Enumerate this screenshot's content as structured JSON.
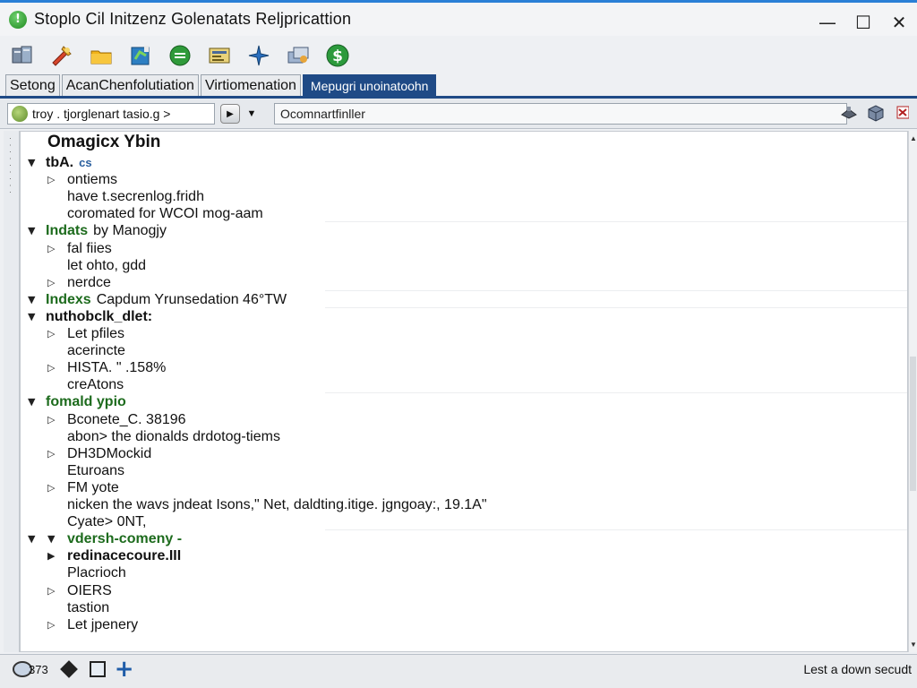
{
  "window": {
    "title": "Stoplo Cil Initzenz Golenatats Reljpricattion",
    "controls": {
      "minimize": "—",
      "maximize": "☐",
      "close": "✕"
    }
  },
  "toolbar": {
    "icons": [
      "database-icon",
      "tools-icon",
      "folder-icon",
      "book-icon",
      "refresh-icon",
      "document-icon",
      "star-icon",
      "stack-icon",
      "dollar-icon"
    ]
  },
  "tabs": [
    {
      "label": "Setong",
      "active": false
    },
    {
      "label": "AcanChenfolutiation",
      "active": false
    },
    {
      "label": "Virtiomenation",
      "active": false
    },
    {
      "label": "Mepugri unoinatoohn",
      "active": true
    }
  ],
  "address": {
    "combo_text": "troy .  tjorglenart tasio.g >",
    "filter_value": "Ocomnartfinller"
  },
  "tree": {
    "header": "Omagicx Ybin",
    "rows": [
      {
        "toggle": "▼",
        "indent": 0,
        "text": "tbA.",
        "style": "bold",
        "extra": "cs"
      },
      {
        "toggle": "▷",
        "indent": 1,
        "text": "ontiems",
        "style": ""
      },
      {
        "toggle": "",
        "indent": 1,
        "text": "have t.secrenlog.fridh",
        "style": ""
      },
      {
        "toggle": "",
        "indent": 1,
        "text": "coromated for WCOI mog-aam",
        "style": ""
      },
      {
        "toggle": "▼",
        "indent": 0,
        "text": "Indats",
        "style": "green",
        "extra": "by Manogjy"
      },
      {
        "toggle": "▷",
        "indent": 1,
        "text": "fal fiies",
        "style": ""
      },
      {
        "toggle": "",
        "indent": 1,
        "text": "let ohto, gdd",
        "style": ""
      },
      {
        "toggle": "▷",
        "indent": 1,
        "text": "nerdce",
        "style": ""
      },
      {
        "toggle": "▼",
        "indent": 0,
        "text": "Indexs",
        "style": "green",
        "extra": "Capdum Yrunsedation 46°TW"
      },
      {
        "toggle": "▼",
        "indent": 0,
        "text": "nuthobclk_dlet:",
        "style": "bold"
      },
      {
        "toggle": "▷",
        "indent": 1,
        "text": "Let pfiles",
        "style": ""
      },
      {
        "toggle": "",
        "indent": 1,
        "text": "acerincte",
        "style": ""
      },
      {
        "toggle": "▷",
        "indent": 1,
        "text": "HISTA. \" .158%",
        "style": ""
      },
      {
        "toggle": "",
        "indent": 1,
        "text": "creAtons",
        "style": ""
      },
      {
        "toggle": "▼",
        "indent": 0,
        "text": "fomald ypio",
        "style": "green"
      },
      {
        "toggle": "▷",
        "indent": 1,
        "text": "Bconete_C. 38196",
        "style": ""
      },
      {
        "toggle": "",
        "indent": 1,
        "text": "abon> the dionalds drdotog-tiems",
        "style": ""
      },
      {
        "toggle": "▷",
        "indent": 1,
        "text": "DH3DMockid",
        "style": ""
      },
      {
        "toggle": "",
        "indent": 1,
        "text": "Eturoans",
        "style": ""
      },
      {
        "toggle": "▷",
        "indent": 1,
        "text": "FM yote",
        "style": ""
      },
      {
        "toggle": "",
        "indent": 1,
        "text": "nicken the wavs jndeat Isons,\" Net, daldting.itige. jgngoay:, 19.1A\"",
        "style": ""
      },
      {
        "toggle": "",
        "indent": 1,
        "text": "Cyate> 0NT,",
        "style": ""
      },
      {
        "toggle": "▼",
        "indent": 0,
        "text": "vdersh-comeny -",
        "style": "green",
        "second_toggle": "▼"
      },
      {
        "toggle": "▶",
        "indent": 1,
        "text": "redinacecoure.III",
        "style": "bold"
      },
      {
        "toggle": "",
        "indent": 1,
        "text": "Placrioch",
        "style": ""
      },
      {
        "toggle": "▷",
        "indent": 1,
        "text": "OIERS",
        "style": ""
      },
      {
        "toggle": "",
        "indent": 1,
        "text": "tastion",
        "style": ""
      },
      {
        "toggle": "▷",
        "indent": 1,
        "text": "Let jpenery",
        "style": ""
      }
    ]
  },
  "status": {
    "count": "373",
    "right_text": "Lest a down secudt"
  }
}
